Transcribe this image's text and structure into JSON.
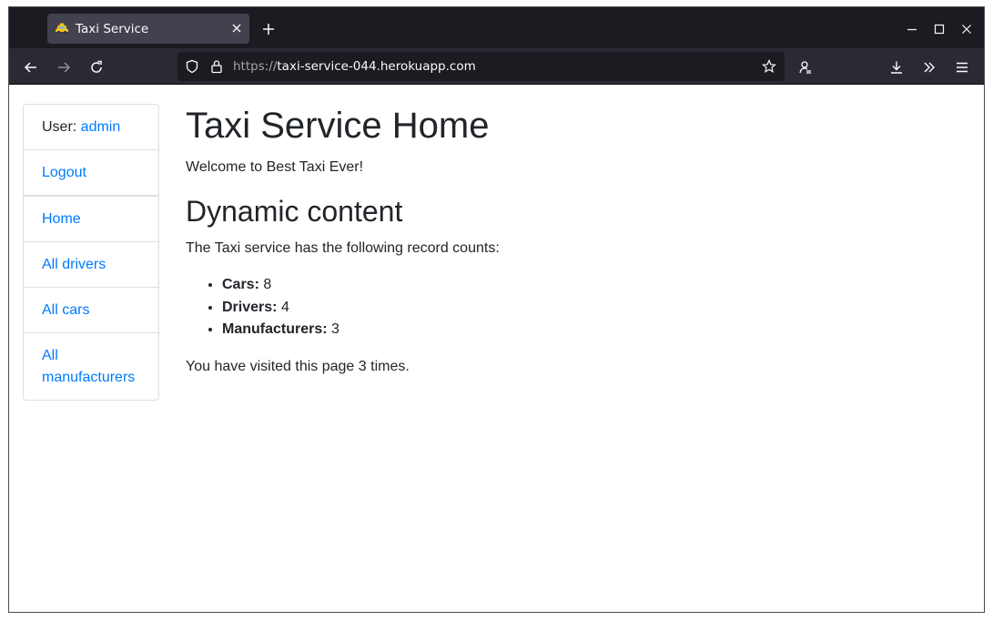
{
  "browser": {
    "tab_title": "Taxi Service",
    "url_scheme": "https://",
    "url_host": "taxi-service-044.herokuapp.com"
  },
  "sidebar": {
    "user_label": "User: ",
    "user_name": "admin",
    "items": [
      {
        "label": "Logout"
      },
      {
        "label": "Home"
      },
      {
        "label": "All drivers"
      },
      {
        "label": "All cars"
      },
      {
        "label": "All manufacturers"
      }
    ]
  },
  "main": {
    "title": "Taxi Service Home",
    "welcome": "Welcome to Best Taxi Ever!",
    "subtitle": "Dynamic content",
    "counts_intro": "The Taxi service has the following record counts:",
    "counts": [
      {
        "label": "Cars:",
        "value": "8"
      },
      {
        "label": "Drivers:",
        "value": "4"
      },
      {
        "label": "Manufacturers:",
        "value": "3"
      }
    ],
    "visits_prefix": "You have visited this page ",
    "visits": "3",
    "visits_suffix": " times."
  },
  "colors": {
    "link": "#007bff",
    "text": "#212529",
    "tabstrip": "#1c1b22",
    "toolbar": "#2b2a33"
  }
}
